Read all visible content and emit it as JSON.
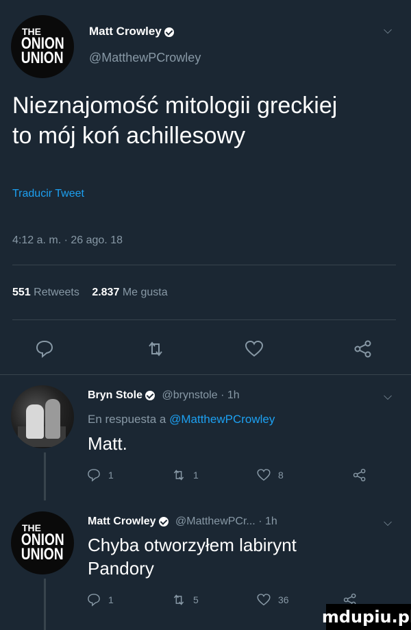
{
  "main_tweet": {
    "author_name": "Matt Crowley",
    "handle": "@MatthewPCrowley",
    "avatar_text": [
      "THE",
      "ONION",
      "UNION"
    ],
    "text_line1": "Nieznajomość mitologii greckiej",
    "text_line2": "to mój koń achillesowy",
    "translate": "Traducir Tweet",
    "timestamp": "4:12 a. m. · 26 ago. 18",
    "retweets_count": "551",
    "retweets_label": "Retweets",
    "likes_count": "2.837",
    "likes_label": "Me gusta"
  },
  "reply1": {
    "author_name": "Bryn Stole",
    "handle_time": "@brynstole · 1h",
    "reply_prefix": "En respuesta a",
    "reply_to": "@MatthewPCrowley",
    "text": "Matt.",
    "reply_count": "1",
    "retweet_count": "1",
    "like_count": "8"
  },
  "reply2": {
    "author_name": "Matt Crowley",
    "handle_time": "@MatthewPCr... · 1h",
    "avatar_text": [
      "THE",
      "ONION",
      "UNION"
    ],
    "text_line1": "Chyba otworzyłem labirynt",
    "text_line2": "Pandory",
    "reply_count": "1",
    "retweet_count": "5",
    "like_count": "36"
  },
  "watermark": "mdupiu.pl"
}
